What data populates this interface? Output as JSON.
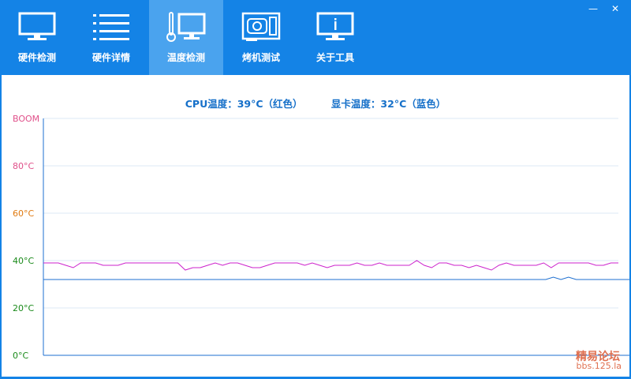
{
  "tabs": [
    {
      "label": "硬件检测",
      "icon": "monitor-icon"
    },
    {
      "label": "硬件详情",
      "icon": "list-icon"
    },
    {
      "label": "温度检测",
      "icon": "thermometer-monitor-icon",
      "active": true
    },
    {
      "label": "烤机测试",
      "icon": "graphics-card-icon"
    },
    {
      "label": "关于工具",
      "icon": "info-monitor-icon"
    }
  ],
  "window": {
    "minimize_icon": "minimize-icon",
    "close_icon": "close-icon",
    "minimize": "—",
    "close": "✕"
  },
  "legend": {
    "cpu": "CPU温度：39°C（红色）",
    "gpu": "显卡温度：32°C（蓝色）"
  },
  "colors": {
    "header": "#1483e6",
    "active_tab": "#4aa3ee",
    "cpu_line": "#cc22cc",
    "gpu_line": "#1e6fd0"
  },
  "chart_data": {
    "type": "line",
    "ylim": [
      0,
      100
    ],
    "yticks": [
      {
        "label": "0°C",
        "value": 0,
        "color": "#1a8a1a"
      },
      {
        "label": "20°C",
        "value": 20,
        "color": "#1a8a1a"
      },
      {
        "label": "40°C",
        "value": 40,
        "color": "#1a8a1a"
      },
      {
        "label": "60°C",
        "value": 60,
        "color": "#e07a10"
      },
      {
        "label": "80°C",
        "value": 80,
        "color": "#e0508a"
      },
      {
        "label": "BOOM",
        "value": 100,
        "color": "#e0508a"
      }
    ],
    "grid": true,
    "series": [
      {
        "color": "#cc22cc",
        "values": [
          39,
          39,
          39,
          38,
          37,
          39,
          39,
          39,
          38,
          38,
          38,
          39,
          39,
          39,
          39,
          39,
          39,
          39,
          39,
          36,
          37,
          37,
          38,
          39,
          38,
          39,
          39,
          38,
          37,
          37,
          38,
          39,
          39,
          39,
          39,
          38,
          39,
          38,
          37,
          38,
          38,
          38,
          39,
          38,
          38,
          39,
          38,
          38,
          38,
          38,
          40,
          38,
          37,
          39,
          39,
          38,
          38,
          37,
          38,
          37,
          36,
          38,
          39,
          38,
          38,
          38,
          38,
          39,
          37,
          39,
          39,
          39,
          39,
          39,
          38,
          38,
          39,
          39
        ]
      },
      {
        "color": "#1e6fd0",
        "values": [
          32,
          32,
          32,
          32,
          32,
          32,
          32,
          32,
          32,
          32,
          32,
          32,
          32,
          32,
          32,
          32,
          32,
          32,
          32,
          32,
          32,
          32,
          32,
          32,
          32,
          32,
          32,
          32,
          32,
          32,
          32,
          32,
          32,
          32,
          32,
          32,
          32,
          32,
          32,
          32,
          32,
          32,
          32,
          32,
          32,
          32,
          32,
          32,
          32,
          32,
          32,
          32,
          32,
          32,
          32,
          32,
          32,
          32,
          32,
          32,
          32,
          32,
          32,
          32,
          32,
          32,
          32,
          33,
          32,
          33,
          32,
          32,
          32,
          32,
          32,
          32,
          32,
          32
        ]
      }
    ]
  },
  "watermark": {
    "line1": "精易论坛",
    "line2": "bbs.125.la"
  }
}
